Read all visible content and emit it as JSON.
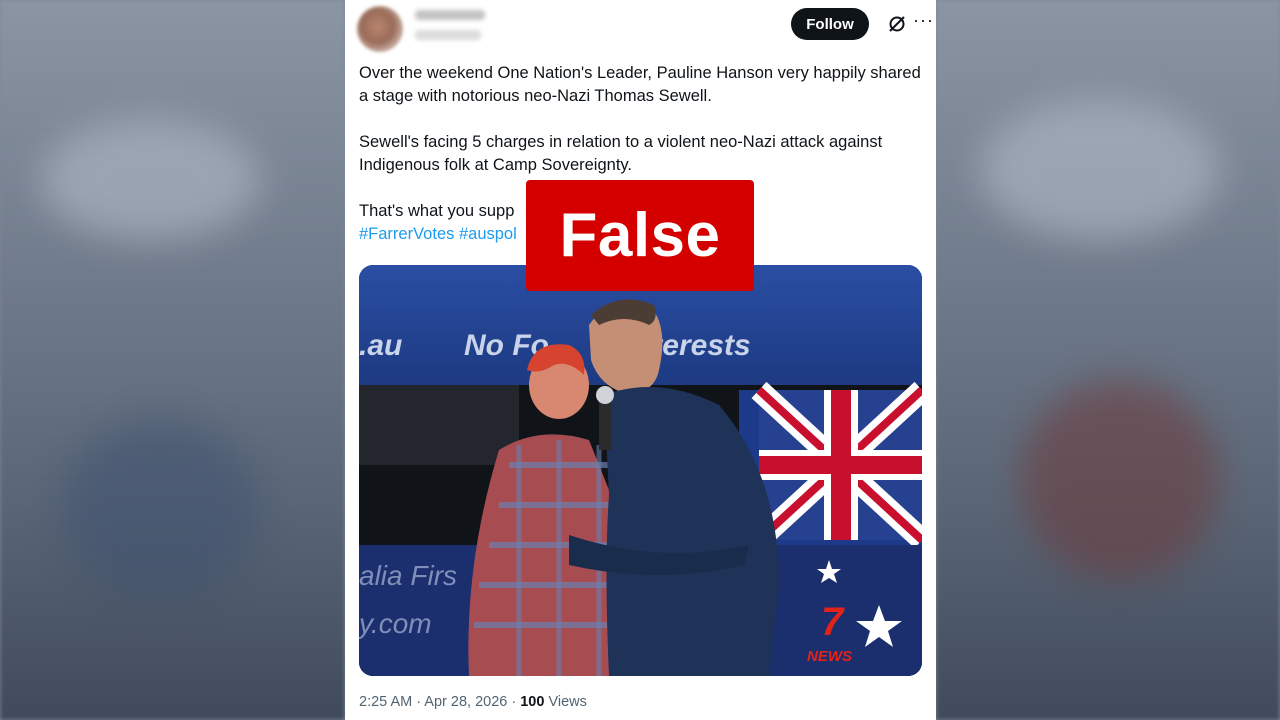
{
  "tweet": {
    "follow_label": "Follow",
    "more_label": "···",
    "paragraphs": [
      "Over the weekend One Nation's Leader, Pauline Hanson very happily shared a stage with notorious neo-Nazi Thomas Sewell.",
      "Sewell's facing 5 charges in relation to a violent neo-Nazi attack against Indigenous folk at Camp Sovereignty.",
      "That's what you supp"
    ],
    "hashtags": [
      "#FarrerVotes",
      "#auspol"
    ],
    "timestamp": "2:25 AM · Apr 28, 2026 · ",
    "views_count": "100",
    "views_label": " Views"
  },
  "media": {
    "banner_text_left": ".au",
    "banner_text_right": "No Fo      n interests",
    "sign_text_1": "alia Firs",
    "sign_text_2": "y.com",
    "network_logo_number": "7",
    "network_logo_text": "NEWS"
  },
  "overlay": {
    "verdict": "False",
    "color": "#d40000"
  },
  "icons": {
    "grok": "grok-icon",
    "more": "more-icon"
  }
}
